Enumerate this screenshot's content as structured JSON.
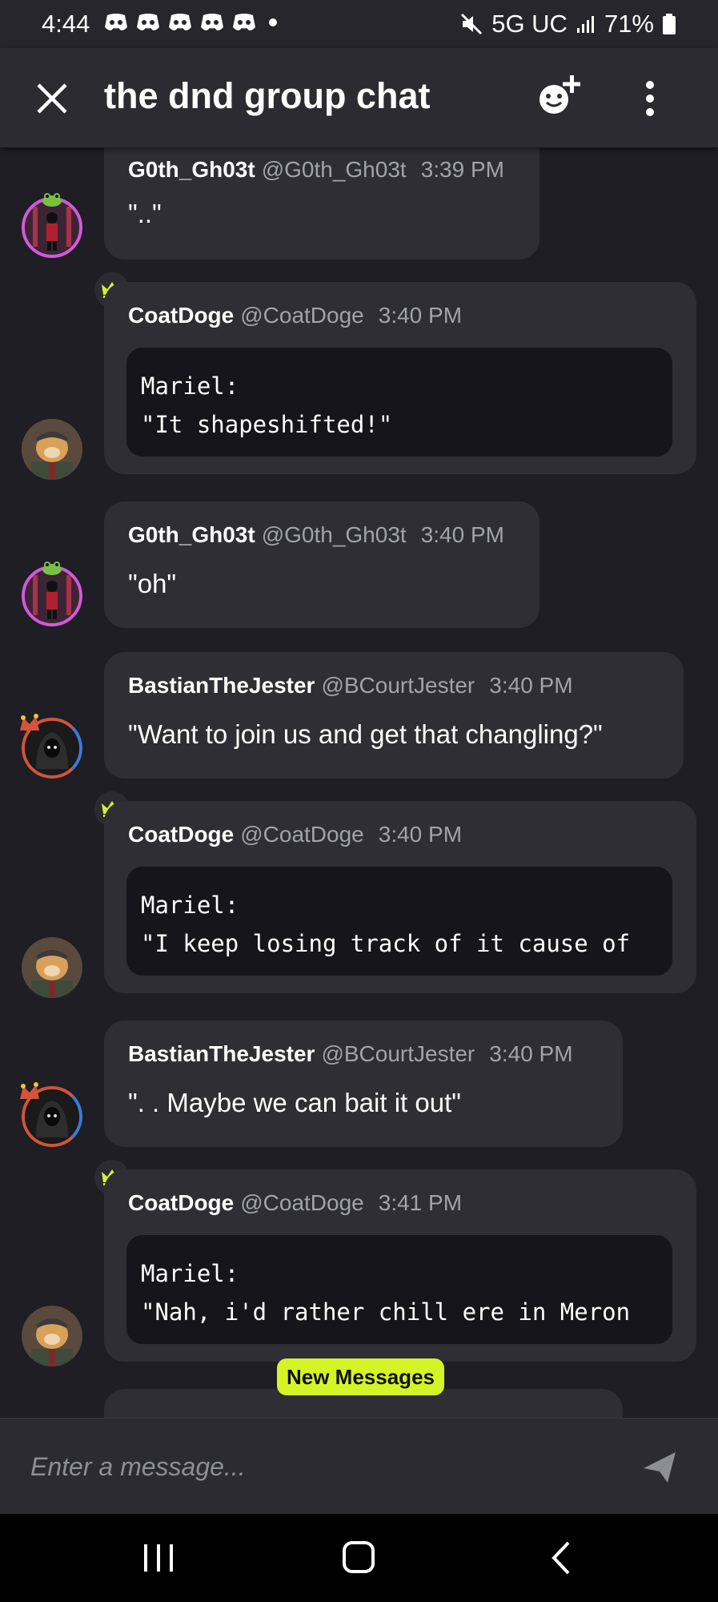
{
  "status_bar": {
    "time": "4:44",
    "network": "5G UC",
    "battery": "71%"
  },
  "header": {
    "title": "the dnd group chat"
  },
  "messages": [
    {
      "author": "G0th_Gh03t",
      "handle": "@G0th_Gh03t",
      "time": "3:39 PM",
      "text": "\"..\"",
      "avatar": "goth-ghost-avatar"
    },
    {
      "author": "CoatDoge",
      "handle": "@CoatDoge",
      "time": "3:40 PM",
      "code": "Mariel:\n\"It shapeshifted!\"",
      "avatar": "coat-doge-avatar",
      "badge": "crown-icon"
    },
    {
      "author": "G0th_Gh03t",
      "handle": "@G0th_Gh03t",
      "time": "3:40 PM",
      "text": "\"oh\"",
      "avatar": "goth-ghost-avatar"
    },
    {
      "author": "BastianTheJester",
      "handle": "@BCourtJester",
      "time": "3:40 PM",
      "text": "\"Want to join us and get that changling?\"",
      "avatar": "jester-avatar"
    },
    {
      "author": "CoatDoge",
      "handle": "@CoatDoge",
      "time": "3:40 PM",
      "code": "Mariel:\n\"I keep losing track of it cause of",
      "avatar": "coat-doge-avatar",
      "badge": "crown-icon"
    },
    {
      "author": "BastianTheJester",
      "handle": "@BCourtJester",
      "time": "3:40 PM",
      "text": "\". . Maybe we can bait it out\"",
      "avatar": "jester-avatar"
    },
    {
      "author": "CoatDoge",
      "handle": "@CoatDoge",
      "time": "3:41 PM",
      "code": "Mariel:\n\"Nah, i'd rather chill ere in Meron",
      "avatar": "coat-doge-avatar",
      "badge": "crown-icon"
    }
  ],
  "new_messages_label": "New Messages",
  "composer": {
    "placeholder": "Enter a message..."
  },
  "colors": {
    "background": "#1e1e24",
    "bubble": "#2e2e34",
    "accent": "#d4f425",
    "codeblock": "#15151b"
  }
}
